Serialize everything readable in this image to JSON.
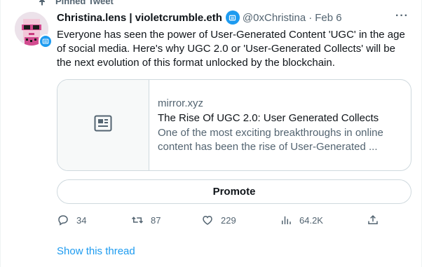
{
  "pinned_label": "Pinned Tweet",
  "author": {
    "name": "Christina.lens | violetcrumble.eth",
    "handle": "@0xChristina",
    "separator": "·",
    "date": "Feb 6"
  },
  "more_label": "···",
  "tweet_text": "Everyone has seen the power of User-Generated Content 'UGC' in the age of social media. Here's why UGC 2.0 or 'User-Generated Collects' will be the next evolution of this format unlocked by the blockchain.",
  "card": {
    "domain": "mirror.xyz",
    "title": "The Rise Of UGC 2.0: User Generated Collects",
    "description": "One of the most exciting breakthroughs in online content has been the rise of User-Generated ..."
  },
  "promote_label": "Promote",
  "actions": {
    "replies": "34",
    "retweets": "87",
    "likes": "229",
    "views": "64.2K"
  },
  "show_thread_label": "Show this thread",
  "colors": {
    "accent": "#1d9bf0",
    "text": "#0f1419",
    "muted": "#536471",
    "border": "#cfd9de"
  },
  "icons": [
    "pin-icon",
    "verified-icon",
    "more-icon",
    "article-icon",
    "reply-icon",
    "retweet-icon",
    "like-icon",
    "views-icon",
    "share-icon"
  ]
}
